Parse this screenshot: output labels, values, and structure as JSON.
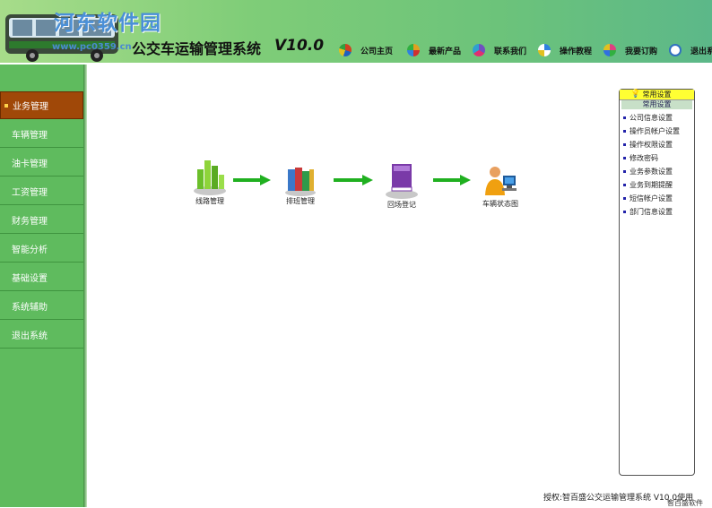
{
  "header": {
    "watermark": "河东软件园",
    "watermark_sub": "www.pc0359.cn",
    "title": "公交车运输管理系统",
    "version": "V10.0",
    "nav": [
      {
        "label": "公司主页",
        "icon": "pie-chart-icon",
        "color": "#d04020"
      },
      {
        "label": "最新产品",
        "icon": "color-wheel-icon",
        "color": "#e0a020"
      },
      {
        "label": "联系我们",
        "icon": "palette-icon",
        "color": "#7050c0"
      },
      {
        "label": "操作教程",
        "icon": "star-pinwheel-icon",
        "color": "#3080e0"
      },
      {
        "label": "我要订购",
        "icon": "flower-icon",
        "color": "#e04080"
      },
      {
        "label": "退出系",
        "icon": "magnifier-icon",
        "color": "#3070c0"
      }
    ]
  },
  "sidebar": {
    "items": [
      {
        "label": "业务管理",
        "active": true
      },
      {
        "label": "车辆管理",
        "active": false
      },
      {
        "label": "油卡管理",
        "active": false
      },
      {
        "label": "工资管理",
        "active": false
      },
      {
        "label": "财务管理",
        "active": false
      },
      {
        "label": "智能分析",
        "active": false
      },
      {
        "label": "基础设置",
        "active": false
      },
      {
        "label": "系统辅助",
        "active": false
      },
      {
        "label": "退出系统",
        "active": false
      }
    ]
  },
  "flow": {
    "nodes": [
      {
        "label": "线路管理",
        "icon": "bar-chart-icon"
      },
      {
        "label": "排班管理",
        "icon": "books-icon"
      },
      {
        "label": "回场登记",
        "icon": "purple-book-icon"
      },
      {
        "label": "车辆状态图",
        "icon": "operator-computer-icon"
      }
    ],
    "arrow_color": "#20b020"
  },
  "panel": {
    "title": "常用设置",
    "subtitle": "常用设置",
    "links": [
      "公司信息设置",
      "操作员帐户设置",
      "操作权限设置",
      "修改密码",
      "业务参数设置",
      "业务到期提醒",
      "短信帐户设置",
      "部门信息设置"
    ]
  },
  "footer": {
    "text": "授权:智百盛公交运输管理系统 V10.0使用",
    "overlay": "智百盛软件"
  }
}
